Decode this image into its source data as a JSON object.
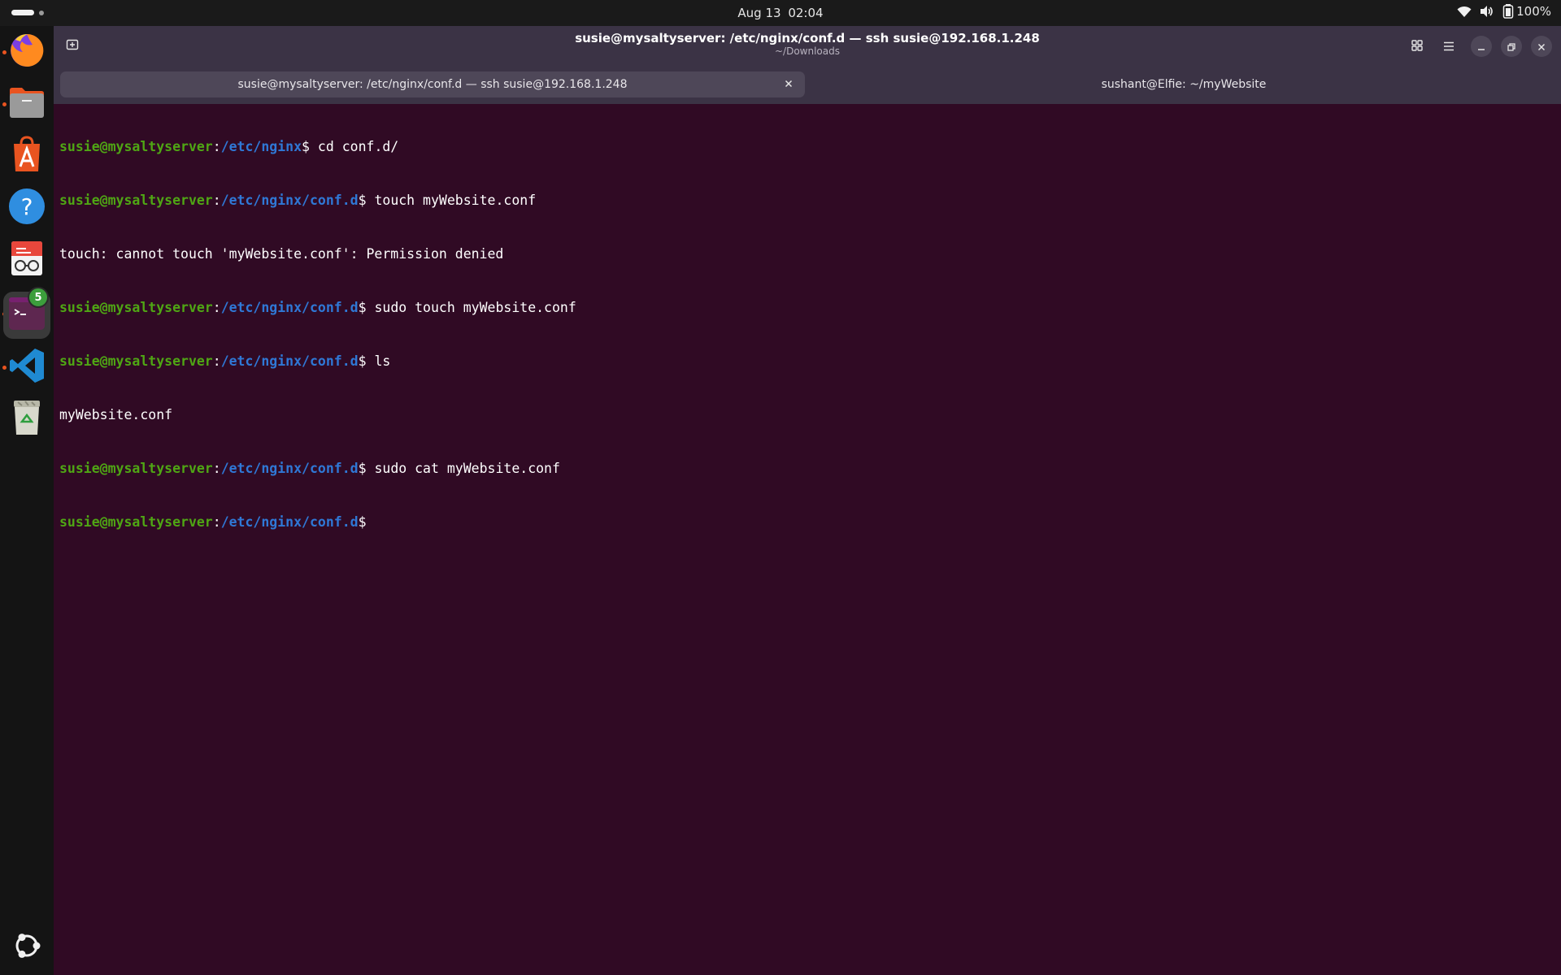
{
  "topbar": {
    "date": "Aug 13",
    "time": "02:04",
    "battery": "100%",
    "icons": [
      "wifi-icon",
      "volume-icon",
      "battery-icon"
    ]
  },
  "dock": {
    "items": [
      {
        "name": "firefox",
        "icon": "firefox-icon",
        "running": true
      },
      {
        "name": "files",
        "icon": "folder-icon",
        "running": true
      },
      {
        "name": "app-center",
        "icon": "app-center-icon",
        "running": false
      },
      {
        "name": "help",
        "icon": "help-icon",
        "running": false
      },
      {
        "name": "document-viewer",
        "icon": "document-viewer-icon",
        "running": false
      },
      {
        "name": "terminal",
        "icon": "terminal-icon",
        "running": true,
        "badge": "5",
        "active": true
      },
      {
        "name": "vscode",
        "icon": "vscode-icon",
        "running": true
      },
      {
        "name": "trash",
        "icon": "trash-icon",
        "running": false
      }
    ],
    "show_apps_icon": "ubuntu-logo-icon"
  },
  "window": {
    "title": "susie@mysaltyserver: /etc/nginx/conf.d — ssh susie@192.168.1.248",
    "subtitle": "~/Downloads",
    "tabs": [
      {
        "label": "susie@mysaltyserver: /etc/nginx/conf.d — ssh susie@192.168.1.248",
        "active": true
      },
      {
        "label": "sushant@Elfie: ~/myWebsite",
        "active": false
      }
    ],
    "colors": {
      "background": "#300a24",
      "user": "#4fa614",
      "path": "#2f78d6",
      "headerbar": "#3b3345"
    }
  },
  "terminal": {
    "lines": [
      {
        "type": "prompt",
        "user": "susie@mysaltyserver",
        "sep": ":",
        "path": "/etc/nginx",
        "dollar": "$",
        "cmd": " cd conf.d/"
      },
      {
        "type": "prompt",
        "user": "susie@mysaltyserver",
        "sep": ":",
        "path": "/etc/nginx/conf.d",
        "dollar": "$",
        "cmd": " touch myWebsite.conf"
      },
      {
        "type": "output",
        "text": "touch: cannot touch 'myWebsite.conf': Permission denied"
      },
      {
        "type": "prompt",
        "user": "susie@mysaltyserver",
        "sep": ":",
        "path": "/etc/nginx/conf.d",
        "dollar": "$",
        "cmd": " sudo touch myWebsite.conf"
      },
      {
        "type": "prompt",
        "user": "susie@mysaltyserver",
        "sep": ":",
        "path": "/etc/nginx/conf.d",
        "dollar": "$",
        "cmd": " ls"
      },
      {
        "type": "output",
        "text": "myWebsite.conf"
      },
      {
        "type": "prompt",
        "user": "susie@mysaltyserver",
        "sep": ":",
        "path": "/etc/nginx/conf.d",
        "dollar": "$",
        "cmd": " sudo cat myWebsite.conf"
      },
      {
        "type": "prompt",
        "user": "susie@mysaltyserver",
        "sep": ":",
        "path": "/etc/nginx/conf.d",
        "dollar": "$",
        "cmd": ""
      }
    ]
  }
}
